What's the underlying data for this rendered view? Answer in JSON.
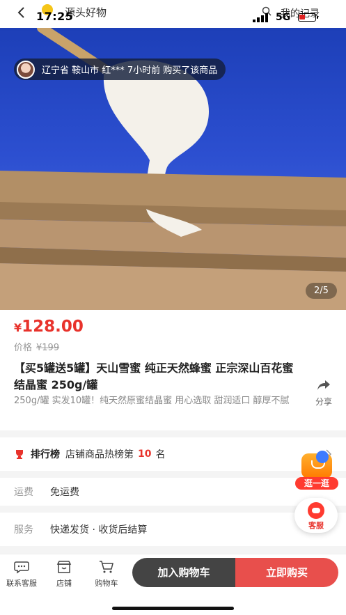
{
  "status_bar": {
    "time": "17:25",
    "network": "5G"
  },
  "nav": {
    "title": "源头好物",
    "records_label": "我的记录"
  },
  "hero": {
    "buyer_notice": "辽宁省 鞍山市 红*** 7小时前 购买了该商品",
    "image_counter": "2/5"
  },
  "product": {
    "currency": "¥",
    "price": "128.00",
    "original_price_label": "价格",
    "original_price": "¥199",
    "title": "【买5罐送5罐】天山雪蜜 纯正天然蜂蜜 正宗深山百花蜜结晶蜜 250g/罐",
    "description": "250g/罐 实发10罐！纯天然原蜜结晶蜜 用心选取 甜润适口 醇厚不腻",
    "share_label": "分享"
  },
  "ranking": {
    "title": "排行榜",
    "text_before": "店铺商品热榜第",
    "rank": "10",
    "text_after": "名"
  },
  "shipping": {
    "label": "运费",
    "value": "免运费"
  },
  "service": {
    "label": "服务",
    "value": "快递发货 · 收货后结算"
  },
  "floating": {
    "browse_label": "逛一逛",
    "service_label": "客服"
  },
  "bottom_bar": {
    "contact_label": "联系客服",
    "store_label": "店铺",
    "cart_label": "购物车",
    "add_to_cart": "加入购物车",
    "buy_now": "立即购买"
  },
  "colors": {
    "accent_red": "#e8322b",
    "cart_button": "#444444",
    "buy_button": "#e84f4c"
  }
}
